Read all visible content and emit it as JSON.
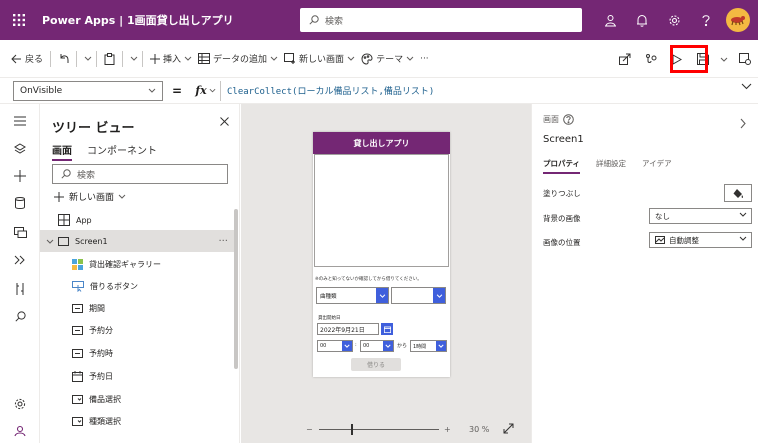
{
  "titlebar": {
    "app_title": "Power Apps | 1画面貸し出しアプリ",
    "search_placeholder": "検索",
    "bg_color": "#742774",
    "icons": [
      "waffle-icon",
      "environment-icon",
      "bell-icon",
      "gear-icon",
      "help-icon",
      "avatar"
    ]
  },
  "commandbar": {
    "back": "戻る",
    "insert": "挿入",
    "add_data": "データの追加",
    "new_screen": "新しい画面",
    "theme": "テーマ",
    "more": "···",
    "highlight_color": "#ff0000"
  },
  "formulabar": {
    "property": "OnVisible",
    "equals": "=",
    "fx": "fx",
    "formula": "ClearCollect(ローカル備品リスト,備品リスト)"
  },
  "treeview": {
    "title": "ツリー ビュー",
    "tab_screens": "画面",
    "tab_components": "コンポーネント",
    "search_placeholder": "検索",
    "new_screen": "新しい画面",
    "items": [
      {
        "label": "App",
        "icon": "app-icon"
      },
      {
        "label": "Screen1",
        "icon": "screen-icon"
      },
      {
        "label": "貸出確認ギャラリー",
        "icon": "gallery-icon"
      },
      {
        "label": "借りるボタン",
        "icon": "button-icon"
      },
      {
        "label": "期間",
        "icon": "textbox-icon"
      },
      {
        "label": "予約分",
        "icon": "textbox-icon"
      },
      {
        "label": "予約時",
        "icon": "textbox-icon"
      },
      {
        "label": "予約日",
        "icon": "calendar-icon"
      },
      {
        "label": "備品選択",
        "icon": "dropdown-icon"
      },
      {
        "label": "種類選択",
        "icon": "dropdown-icon"
      }
    ]
  },
  "canvas": {
    "app_header": "貸し出しアプリ",
    "note": "※のみと知ってないか確認してから借りてください。",
    "dropdown1": "曲種類",
    "date_label": "貸出開始日",
    "date_value": "2022年9月21日",
    "hour": "00",
    "colon": ":",
    "minute": "00",
    "from": "から",
    "duration": "1時間",
    "borrow_button": "借りる",
    "zoom_minus": "−",
    "zoom_plus": "+",
    "zoom_value": "30 %",
    "zoom_level_percent": 30
  },
  "properties": {
    "kind": "画面",
    "name": "Screen1",
    "tab_props": "プロパティ",
    "tab_advanced": "詳細設定",
    "tab_ideas": "アイデア",
    "fill_label": "塗りつぶし",
    "bg_image_label": "背景の画像",
    "bg_image_value": "なし",
    "image_position_label": "画像の位置",
    "image_position_value": "自動調整"
  }
}
